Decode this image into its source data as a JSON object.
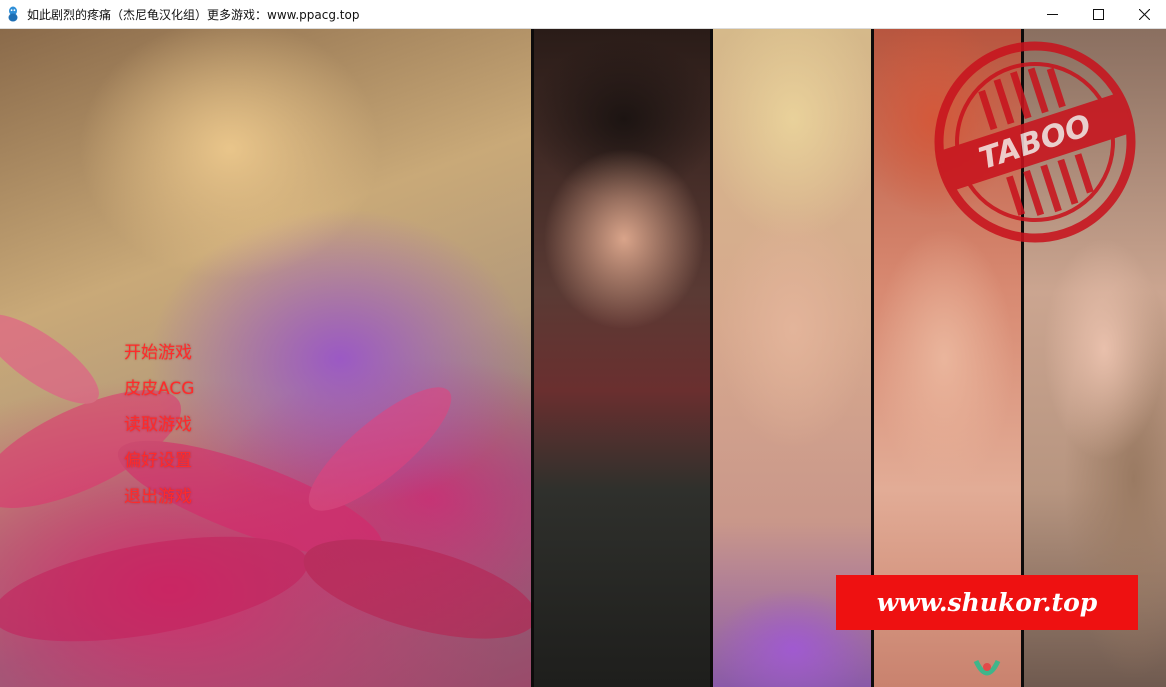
{
  "window": {
    "title": "如此剧烈的疼痛（杰尼龟汉化组）更多游戏：www.ppacg.top",
    "icon": "turtle-app-icon",
    "controls": [
      "minimize-icon",
      "maximize-icon",
      "close-icon"
    ]
  },
  "menu": {
    "items": [
      {
        "label": "开始游戏"
      },
      {
        "label": "皮皮ACG"
      },
      {
        "label": "读取游戏"
      },
      {
        "label": "偏好设置"
      },
      {
        "label": "退出游戏"
      }
    ],
    "color": "#ff2a2a"
  },
  "stamp": {
    "text": "TABOO",
    "color": "#c8141e"
  },
  "watermark": {
    "text": "www.shukor.top",
    "background": "#ee1111"
  }
}
